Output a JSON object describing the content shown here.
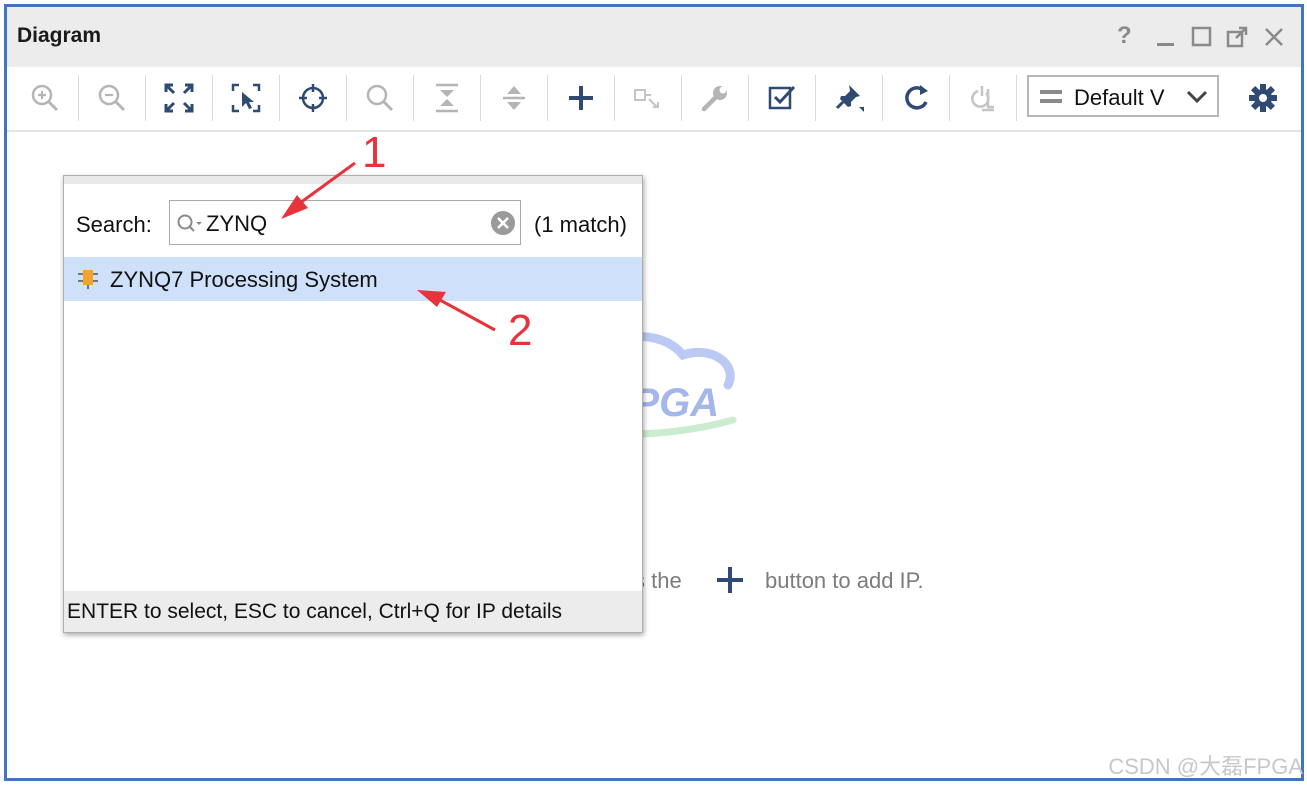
{
  "window": {
    "title": "Diagram",
    "controls": [
      "help-icon",
      "minimize-icon",
      "maximize-icon",
      "undock-icon",
      "close-icon"
    ],
    "help_label": "?"
  },
  "toolbar": {
    "buttons": [
      "zoom-in-icon",
      "zoom-out-icon",
      "zoom-fit-icon",
      "zoom-area-icon",
      "center-icon",
      "search-icon",
      "collapse-all-icon",
      "expand-all-icon",
      "add-ip-icon",
      "make-connection-icon",
      "customize-icon",
      "validate-icon",
      "pin-icon",
      "regenerate-layout-icon",
      "optimize-routing-icon"
    ],
    "view_select": "Default V",
    "settings_icon": "gear-icon"
  },
  "canvas": {
    "hint_left": "s the",
    "hint_right": "button to add IP."
  },
  "popup": {
    "search_label": "Search:",
    "search_value": "ZYNQ",
    "match_count": "(1 match)",
    "results": [
      {
        "label": "ZYNQ7 Processing System",
        "icon": "ip-core-icon",
        "selected": true
      }
    ],
    "footer": "ENTER to select, ESC to cancel, Ctrl+Q for IP details"
  },
  "annotations": {
    "step1": "1",
    "step2": "2",
    "color": "#e8323c"
  },
  "watermark": {
    "logo_text": "FPGA",
    "logo_cn": "大磊",
    "corner_text": "CSDN @大磊FPGA"
  },
  "colors": {
    "frame_border": "#4472c4",
    "selection": "#cfe0fb",
    "icon_dark": "#2f4a73"
  }
}
